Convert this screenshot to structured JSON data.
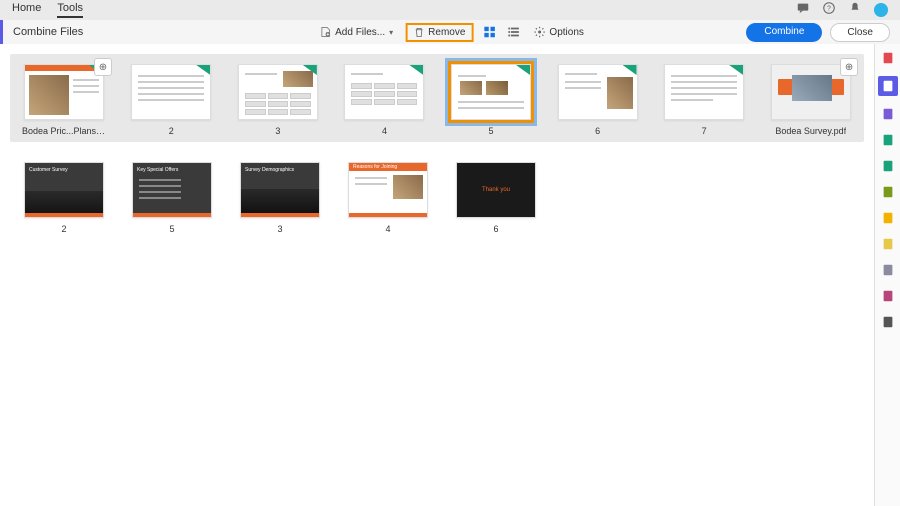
{
  "tabs": {
    "home": "Home",
    "tools": "Tools"
  },
  "toolbar": {
    "title": "Combine Files",
    "add": "Add Files...",
    "remove": "Remove",
    "options": "Options",
    "combine": "Combine",
    "close": "Close"
  },
  "group1": {
    "file_a": "Bodea Pric...Plans.pptx",
    "file_b": "Bodea Survey.pdf",
    "pages": [
      "2",
      "3",
      "4",
      "5",
      "6",
      "7"
    ]
  },
  "group2": {
    "pages": [
      "2",
      "5",
      "3",
      "4",
      "6"
    ]
  },
  "rail": {
    "icons": [
      {
        "name": "export-pdf-icon",
        "color": "#e34850"
      },
      {
        "name": "combine-icon",
        "color": "#5b5be6",
        "active": true
      },
      {
        "name": "edit-pdf-icon",
        "color": "#7a5bd6"
      },
      {
        "name": "export-icon",
        "color": "#1aa27a"
      },
      {
        "name": "organize-icon",
        "color": "#1aa27a"
      },
      {
        "name": "compress-icon",
        "color": "#7a9a1c"
      },
      {
        "name": "comment-icon",
        "color": "#f2b200"
      },
      {
        "name": "protect-icon",
        "color": "#e6c84a"
      },
      {
        "name": "shield-icon",
        "color": "#8a8aa0"
      },
      {
        "name": "sign-icon",
        "color": "#b8457a"
      },
      {
        "name": "redact-icon",
        "color": "#555"
      }
    ]
  }
}
